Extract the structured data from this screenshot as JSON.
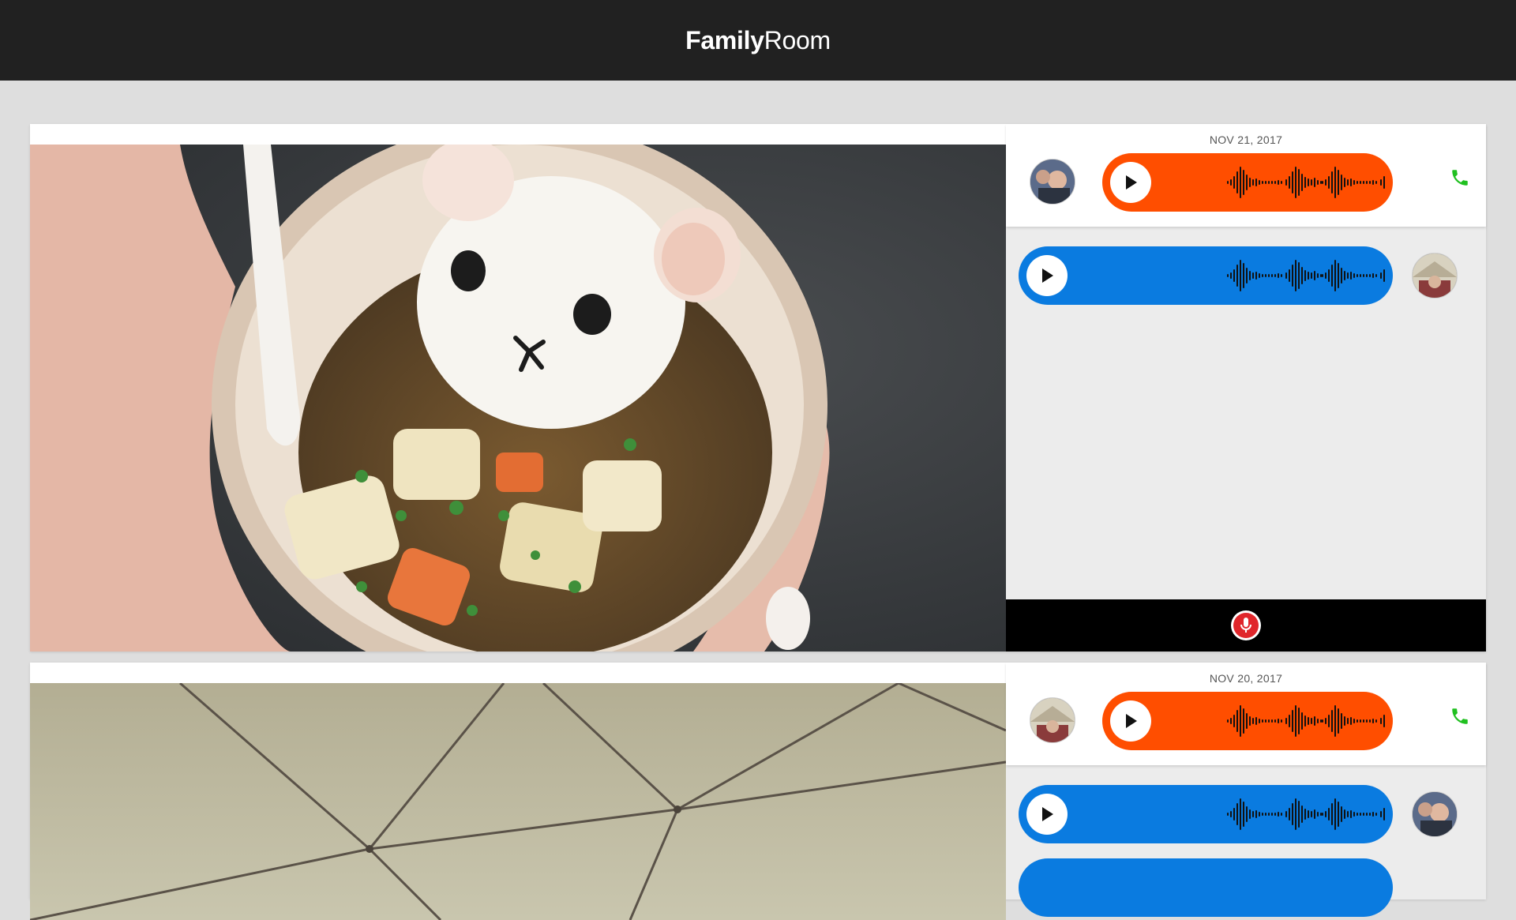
{
  "app": {
    "brand_bold": "Family",
    "brand_light": "Room"
  },
  "colors": {
    "topbar": "#212121",
    "sent_bubble": "#ff4e00",
    "received_bubble": "#0a7be0",
    "call_icon": "#20c020",
    "record_button": "#e0262b"
  },
  "posts": [
    {
      "date": "NOV 21, 2017",
      "photo": "bowl-of-curry-with-bear-shaped-rice",
      "messages": [
        {
          "type": "voice",
          "style": "sent",
          "icon": "play-icon"
        },
        {
          "type": "voice",
          "style": "received",
          "icon": "play-icon"
        }
      ]
    },
    {
      "date": "NOV 20, 2017",
      "photo": "tent-ceiling-with-poles",
      "messages": [
        {
          "type": "voice",
          "style": "sent",
          "icon": "play-icon"
        },
        {
          "type": "voice",
          "style": "received",
          "icon": "play-icon"
        }
      ]
    }
  ]
}
